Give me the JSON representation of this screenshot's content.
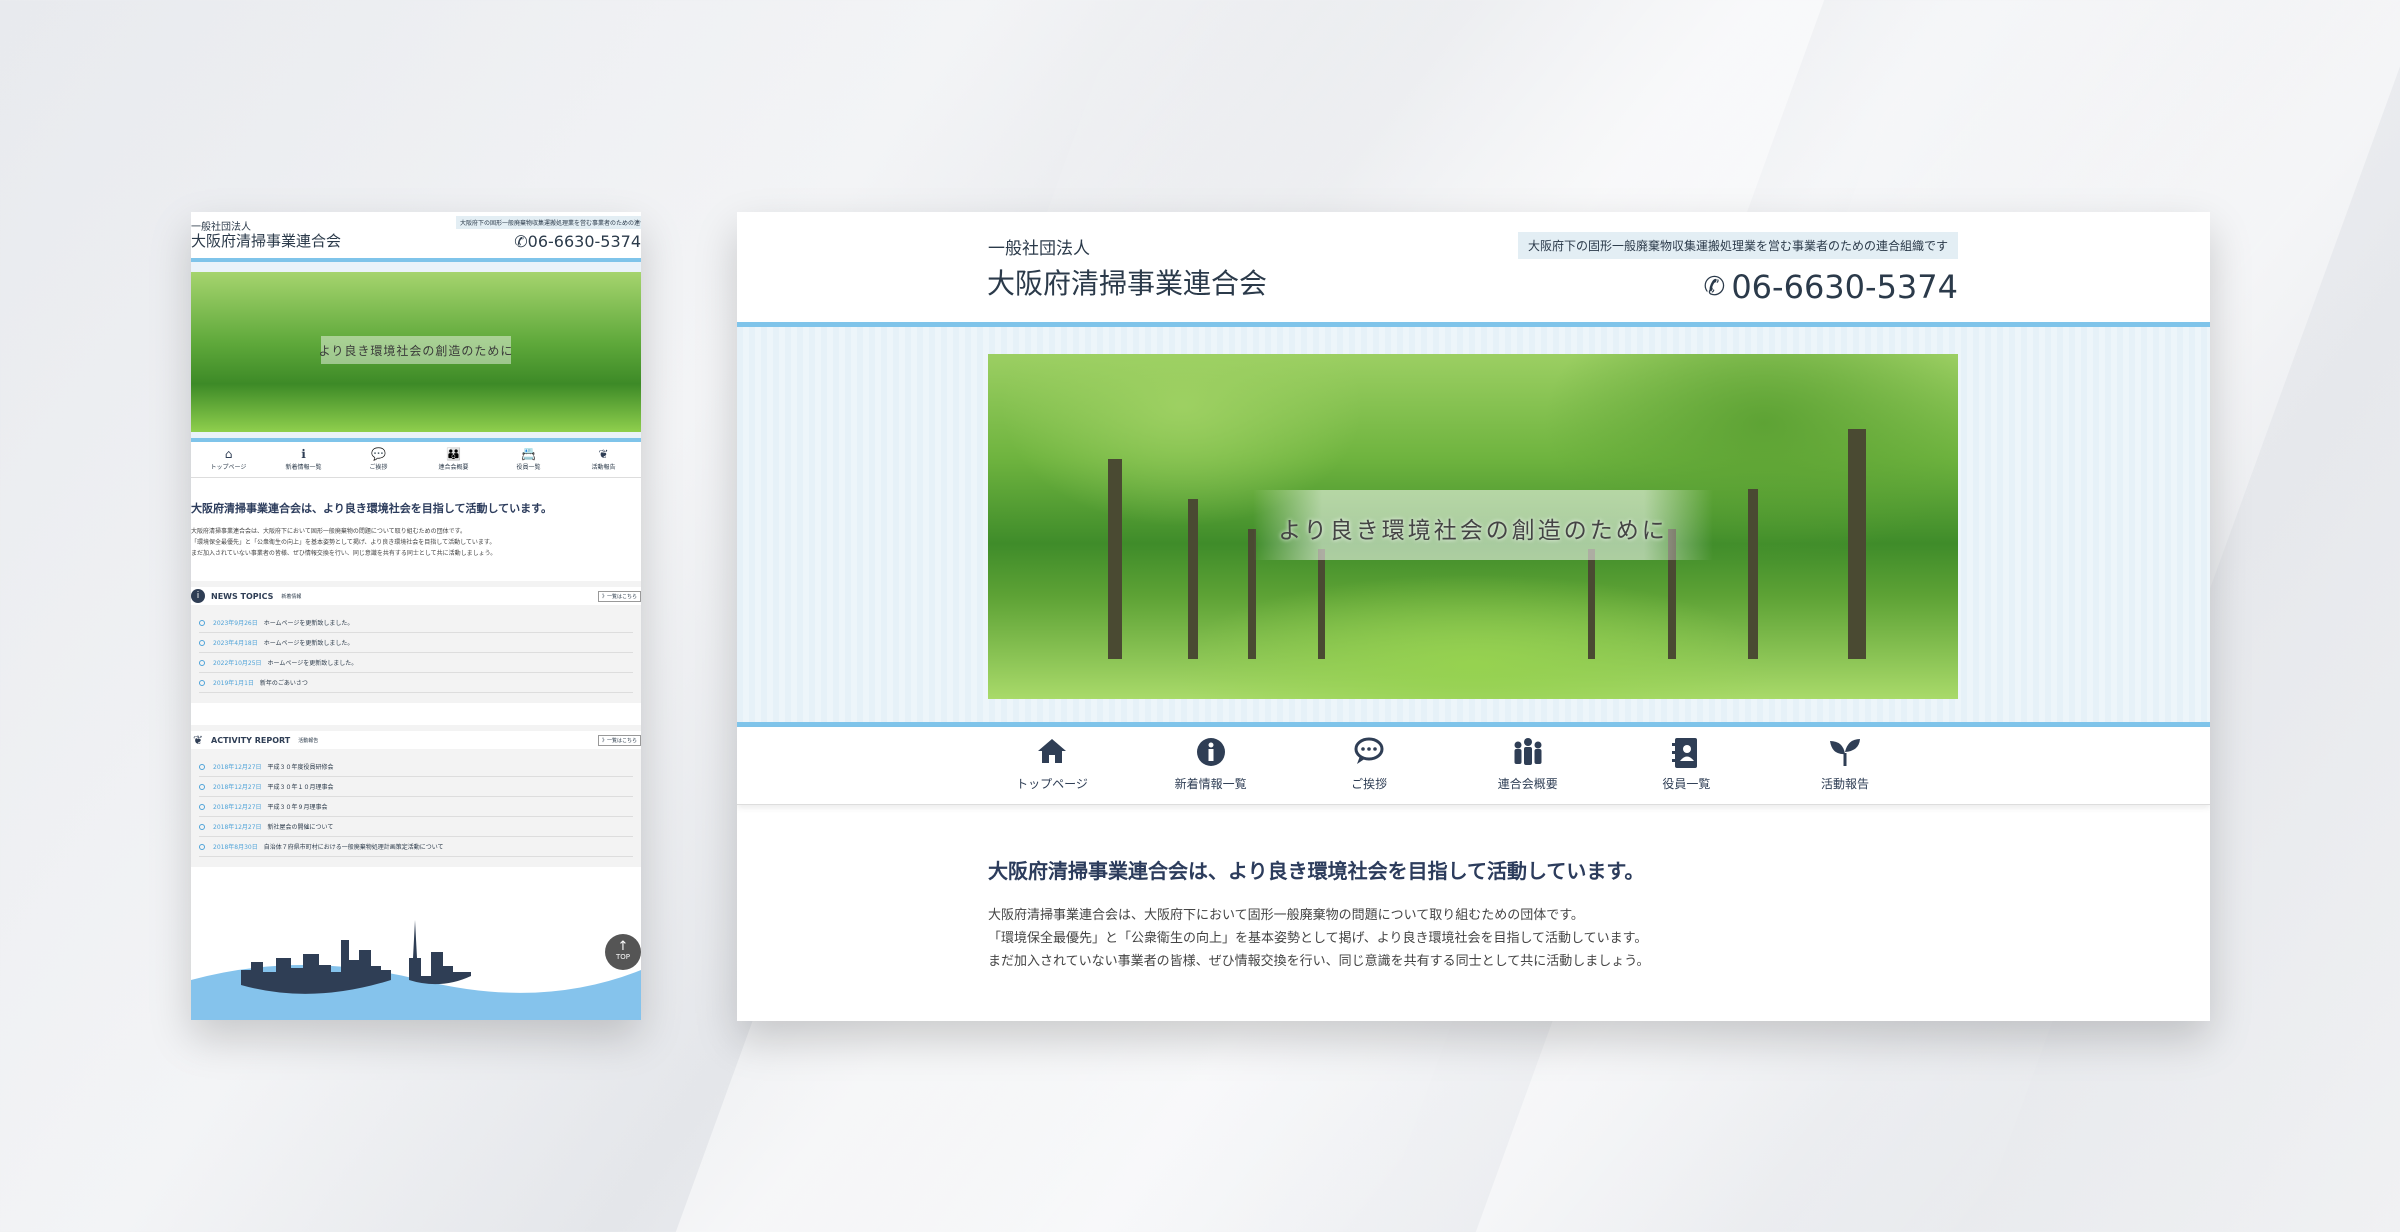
{
  "site": {
    "org_type": "一般社団法人",
    "org_name": "大阪府清掃事業連合会",
    "tagline": "大阪府下の固形一般廃棄物収集運搬処理業を営む事業者のための連合組織です",
    "phone": "06-6630-5374"
  },
  "hero": {
    "caption": "より良き環境社会の創造のために"
  },
  "nav": [
    {
      "label": "トップページ",
      "icon": "home-icon",
      "glyph": "⌂"
    },
    {
      "label": "新着情報一覧",
      "icon": "info-icon",
      "glyph": "ℹ"
    },
    {
      "label": "ご挨拶",
      "icon": "speech-bubble-icon",
      "glyph": "💬"
    },
    {
      "label": "連合会概要",
      "icon": "people-icon",
      "glyph": "👪"
    },
    {
      "label": "役員一覧",
      "icon": "address-book-icon",
      "glyph": "📇"
    },
    {
      "label": "活動報告",
      "icon": "sprout-icon",
      "glyph": "❦"
    }
  ],
  "intro": {
    "title": "大阪府清掃事業連合会は、より良き環境社会を目指して活動しています。",
    "lines": [
      "大阪府清掃事業連合会は、大阪府下において固形一般廃棄物の問題について取り組むための団体です。",
      "「環境保全最優先」と「公衆衛生の向上」を基本姿勢として掲げ、より良き環境社会を目指して活動しています。",
      "まだ加入されていない事業者の皆様、ぜひ情報交換を行い、同じ意識を共有する同士として共に活動しましょう。"
    ]
  },
  "news": {
    "title": "NEWS TOPICS",
    "subtitle": "新着情報",
    "more": "》一覧はこちら",
    "items": [
      {
        "date": "2023年9月26日",
        "text": "ホームページを更新致しました。"
      },
      {
        "date": "2023年4月18日",
        "text": "ホームページを更新致しました。"
      },
      {
        "date": "2022年10月25日",
        "text": "ホームページを更新致しました。"
      },
      {
        "date": "2019年1月1日",
        "text": "新年のごあいさつ"
      }
    ]
  },
  "activity": {
    "title": "ACTIVITY REPORT",
    "subtitle": "活動報告",
    "more": "》一覧はこちら",
    "items": [
      {
        "date": "2018年12月27日",
        "text": "平成３０年度役員研修会"
      },
      {
        "date": "2018年12月27日",
        "text": "平成３０年１０月理事会"
      },
      {
        "date": "2018年12月27日",
        "text": "平成３０年９月理事会"
      },
      {
        "date": "2018年12月27日",
        "text": "新社屋会の開催について"
      },
      {
        "date": "2018年8月30日",
        "text": "自治体７府県市町村における一般廃棄物処理計画策定活動について"
      }
    ]
  },
  "footer": {
    "top_label": "TOP"
  },
  "colors": {
    "accent": "#7fc4ea",
    "navy": "#2f3e55",
    "link": "#4fa3d8"
  }
}
